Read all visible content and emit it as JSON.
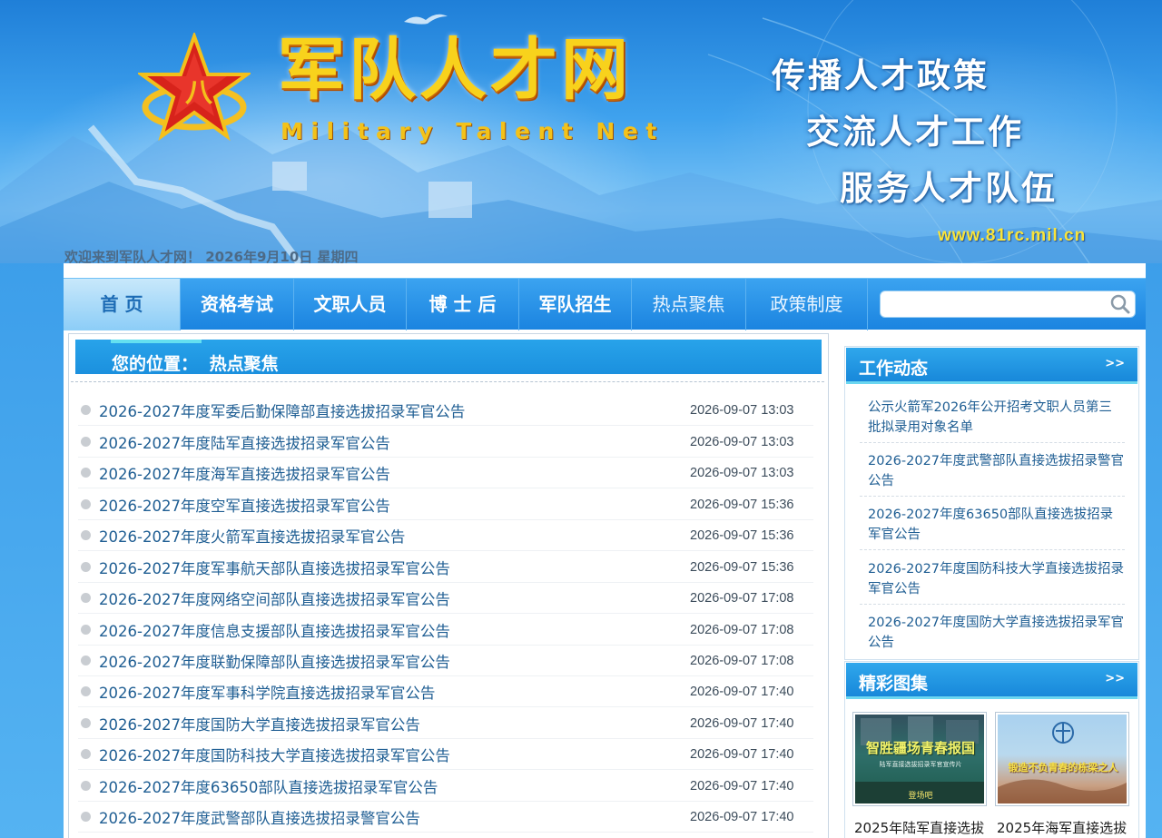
{
  "banner": {
    "title_cn": "军队人才网",
    "title_en": "Military Talent Net",
    "slogans": [
      "传播人才政策",
      "交流人才工作",
      "服务人才队伍"
    ],
    "url": "www.81rc.mil.cn",
    "welcome": "欢迎来到军队人才网！ 2026年9月10日 星期四"
  },
  "nav": {
    "items": [
      "首 页",
      "资格考试",
      "文职人员",
      "博 士 后",
      "军队招生",
      "热点聚焦",
      "政策制度"
    ],
    "search_placeholder": ""
  },
  "breadcrumb": {
    "label": "您的位置：",
    "current": "热点聚焦"
  },
  "articles": [
    {
      "title": "2026-2027年度军委后勤保障部直接选拔招录军官公告",
      "date": "2026-09-07 13:03"
    },
    {
      "title": "2026-2027年度陆军直接选拔招录军官公告",
      "date": "2026-09-07 13:03"
    },
    {
      "title": "2026-2027年度海军直接选拔招录军官公告",
      "date": "2026-09-07 13:03"
    },
    {
      "title": "2026-2027年度空军直接选拔招录军官公告",
      "date": "2026-09-07 15:36"
    },
    {
      "title": "2026-2027年度火箭军直接选拔招录军官公告",
      "date": "2026-09-07 15:36"
    },
    {
      "title": "2026-2027年度军事航天部队直接选拔招录军官公告",
      "date": "2026-09-07 15:36"
    },
    {
      "title": "2026-2027年度网络空间部队直接选拔招录军官公告",
      "date": "2026-09-07 17:08"
    },
    {
      "title": "2026-2027年度信息支援部队直接选拔招录军官公告",
      "date": "2026-09-07 17:08"
    },
    {
      "title": "2026-2027年度联勤保障部队直接选拔招录军官公告",
      "date": "2026-09-07 17:08"
    },
    {
      "title": "2026-2027年度军事科学院直接选拔招录军官公告",
      "date": "2026-09-07 17:40"
    },
    {
      "title": "2026-2027年度国防大学直接选拔招录军官公告",
      "date": "2026-09-07 17:40"
    },
    {
      "title": "2026-2027年度国防科技大学直接选拔招录军官公告",
      "date": "2026-09-07 17:40"
    },
    {
      "title": "2026-2027年度63650部队直接选拔招录军官公告",
      "date": "2026-09-07 17:40"
    },
    {
      "title": "2026-2027年度武警部队直接选拔招录警官公告",
      "date": "2026-09-07 17:40"
    }
  ],
  "work_news": {
    "title": "工作动态",
    "more": ">>",
    "items": [
      "公示火箭军2026年公开招考文职人员第三批拟录用对象名单",
      "2026-2027年度武警部队直接选拔招录警官公告",
      "2026-2027年度63650部队直接选拔招录军官公告",
      "2026-2027年度国防科技大学直接选拔招录军官公告",
      "2026-2027年度国防大学直接选拔招录军官公告"
    ]
  },
  "gallery": {
    "title": "精彩图集",
    "more": ">>",
    "items": [
      {
        "image_text": "智胜疆场青春报国",
        "image_subtext": "陆军直接选拔招录军官宣传片",
        "image_tag": "登场吧",
        "caption": "2025年陆军直接选拔"
      },
      {
        "image_text": "锻造不负青春的栋梁之人",
        "caption": "2025年海军直接选拔"
      }
    ]
  },
  "colors": {
    "accent": "#1b8ee0",
    "link": "#1f5e93",
    "title_gold": "#f8d21c"
  }
}
